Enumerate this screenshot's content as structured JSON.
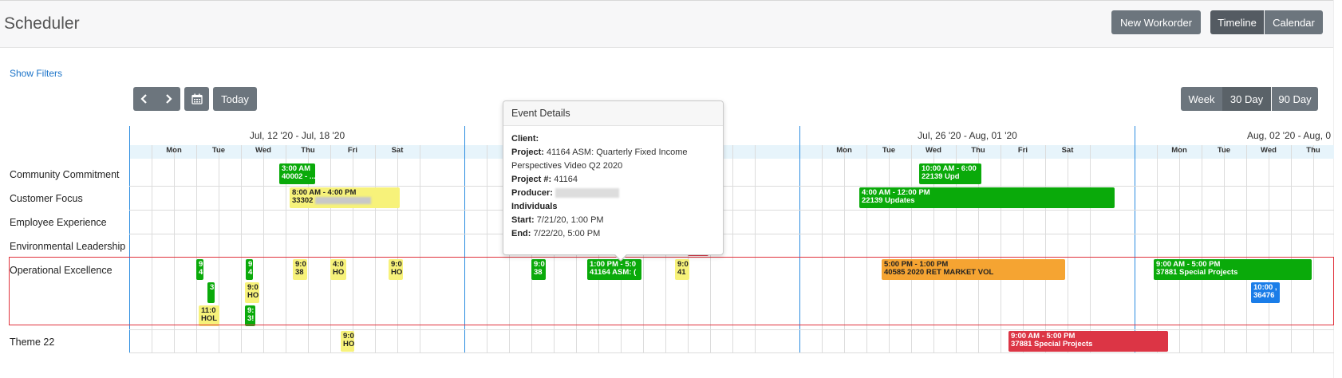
{
  "app": {
    "title": "Scheduler"
  },
  "toolbar": {
    "new_workorder": "New Workorder",
    "timeline": "Timeline",
    "calendar": "Calendar",
    "show_filters": "Show Filters",
    "today": "Today",
    "week": "Week",
    "day30": "30 Day",
    "day90": "90 Day"
  },
  "weeks": [
    {
      "label": "Jul, 12 '20 - Jul, 18 '20"
    },
    {
      "label": ""
    },
    {
      "label": "Jul, 26 '20 - Aug, 01 '20"
    },
    {
      "label": "Aug, 02 '20 - Aug, 0"
    }
  ],
  "day_names": [
    "Mon",
    "Tue",
    "Wed",
    "Thu",
    "Fri",
    "Sat"
  ],
  "rows": [
    {
      "label": "Community Commitment"
    },
    {
      "label": "Customer Focus"
    },
    {
      "label": "Employee Experience"
    },
    {
      "label": "Environmental Leadership"
    },
    {
      "label": "Operational Excellence"
    },
    {
      "label": "Theme 22"
    }
  ],
  "events": [
    {
      "id": "e1",
      "color": "green",
      "l1": "3:00 AM",
      "l2": "40002 - ..."
    },
    {
      "id": "e2",
      "color": "yellow",
      "l1": "8:00 AM - 4:00 PM",
      "l2": "33302"
    },
    {
      "id": "e3",
      "color": "green",
      "l1": "10:00 AM - 6:00",
      "l2": "22139 Upd"
    },
    {
      "id": "e4",
      "color": "green",
      "l1": "4:00 AM - 12:00 PM",
      "l2": "22139 Updates"
    },
    {
      "id": "e5",
      "color": "red",
      "l1": "",
      "l2": ""
    },
    {
      "id": "e6",
      "color": "red",
      "l1": "",
      "l2": ""
    },
    {
      "id": "e7",
      "color": "green",
      "l1": "1:00 PM - 5:0",
      "l2": "41164 ASM: ("
    },
    {
      "id": "e8",
      "color": "green",
      "l1": "9:0",
      "l2": "38"
    },
    {
      "id": "e9",
      "color": "yellow",
      "l1": "9:0",
      "l2": "41"
    },
    {
      "id": "e10",
      "color": "orange",
      "l1": "5:00 PM - 1:00 PM",
      "l2": "40585 2020 RET MARKET VOL"
    },
    {
      "id": "e11",
      "color": "green",
      "l1": "9:00 AM - 5:00 PM",
      "l2": "37881 Special Projects"
    },
    {
      "id": "e12",
      "color": "blue",
      "l1": "10:00 ,",
      "l2": "36476"
    },
    {
      "id": "e13",
      "color": "red",
      "l1": "9:00 AM - 5:00 PM",
      "l2": "37881 Special Projects"
    },
    {
      "id": "e14",
      "color": "green",
      "l1": "9",
      "l2": "4"
    },
    {
      "id": "e15",
      "color": "green",
      "l1": "9",
      "l2": "4"
    },
    {
      "id": "e16",
      "color": "yellow",
      "l1": "9:0",
      "l2": "38"
    },
    {
      "id": "e17",
      "color": "yellow",
      "l1": "4:0",
      "l2": "HO"
    },
    {
      "id": "e18",
      "color": "yellow",
      "l1": "9:0",
      "l2": "HO"
    },
    {
      "id": "e19",
      "color": "green",
      "l1": "3",
      "l2": ""
    },
    {
      "id": "e20",
      "color": "yellow",
      "l1": "9:0",
      "l2": "HO"
    },
    {
      "id": "e21",
      "color": "yellow",
      "l1": "11:0",
      "l2": "HOL"
    },
    {
      "id": "e22",
      "color": "green",
      "l1": "9:",
      "l2": "3!"
    },
    {
      "id": "e23",
      "color": "yellow",
      "l1": "9:0",
      "l2": "HO"
    }
  ],
  "popover": {
    "title": "Event Details",
    "client_label": "Client:",
    "client_value": "",
    "project_label": "Project:",
    "project_value": "41164 ASM: Quarterly Fixed Income Perspectives Video Q2 2020",
    "project_num_label": "Project #:",
    "project_num_value": "41164",
    "producer_label": "Producer:",
    "individuals_label": "Individuals",
    "start_label": "Start:",
    "start_value": "7/21/20, 1:00 PM",
    "end_label": "End:",
    "end_value": "7/22/20, 5:00 PM"
  },
  "colors": {
    "green": "#0aaa0a",
    "yellow": "#f7f27a",
    "red": "#dc3545",
    "orange": "#f5a432",
    "blue": "#1a7de8",
    "button": "#6c757d",
    "button_active": "#545b62",
    "link": "#1a73c8",
    "week_border": "#2b8ce0"
  },
  "icons": [
    "chevron-left-icon",
    "chevron-right-icon",
    "calendar-icon"
  ]
}
